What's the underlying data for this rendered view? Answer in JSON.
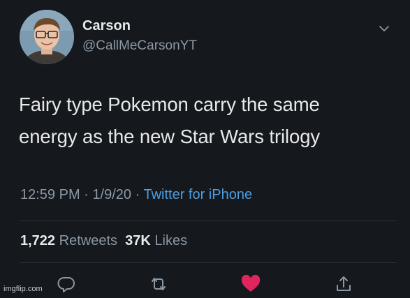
{
  "tweet": {
    "author": {
      "name": "Carson",
      "handle": "@CallMeCarsonYT"
    },
    "text_lines": [
      "Fairy type Pokemon carry the same",
      "energy as the new Star Wars trilogy"
    ],
    "time": "12:59 PM",
    "date": "1/9/20",
    "separator": "·",
    "source": "Twitter for iPhone",
    "stats": {
      "retweets_count": "1,722",
      "retweets_label": "Retweets",
      "likes_count": "37K",
      "likes_label": "Likes"
    },
    "actions": [
      "reply-icon",
      "retweet-icon",
      "like-icon",
      "share-icon"
    ]
  },
  "watermark": "imgflip.com",
  "colors": {
    "background": "#15181c",
    "text": "#e7e9ea",
    "secondary": "#8b98a5",
    "link": "#4d9de0",
    "like": "#e0245e",
    "divider": "#2f3336"
  }
}
